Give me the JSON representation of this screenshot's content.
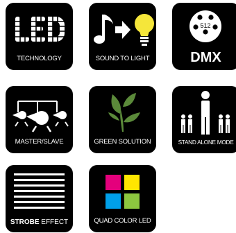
{
  "tiles": [
    {
      "id": "led",
      "caption": "TECHNOLOGY",
      "logo_text": "LED"
    },
    {
      "id": "sound",
      "caption": "SOUND TO LIGHT"
    },
    {
      "id": "dmx",
      "caption": "DMX",
      "badge": "512"
    },
    {
      "id": "master",
      "caption": "MASTER/SLAVE"
    },
    {
      "id": "green",
      "caption": "GREEN SOLUTION"
    },
    {
      "id": "standalone",
      "caption": "STAND ALONE MODE"
    },
    {
      "id": "strobe",
      "caption_bold": "STROBE",
      "caption_rest": " EFFECT"
    },
    {
      "id": "quad",
      "caption": "QUAD COLOR LED"
    }
  ],
  "colors": {
    "tile_bg": "#000000",
    "bulb": "#f5e63a",
    "leaf": "#5b8a3a",
    "magenta": "#e4007c",
    "yellow": "#ffe600",
    "cyan": "#00a0e9",
    "green": "#8cc63f"
  }
}
